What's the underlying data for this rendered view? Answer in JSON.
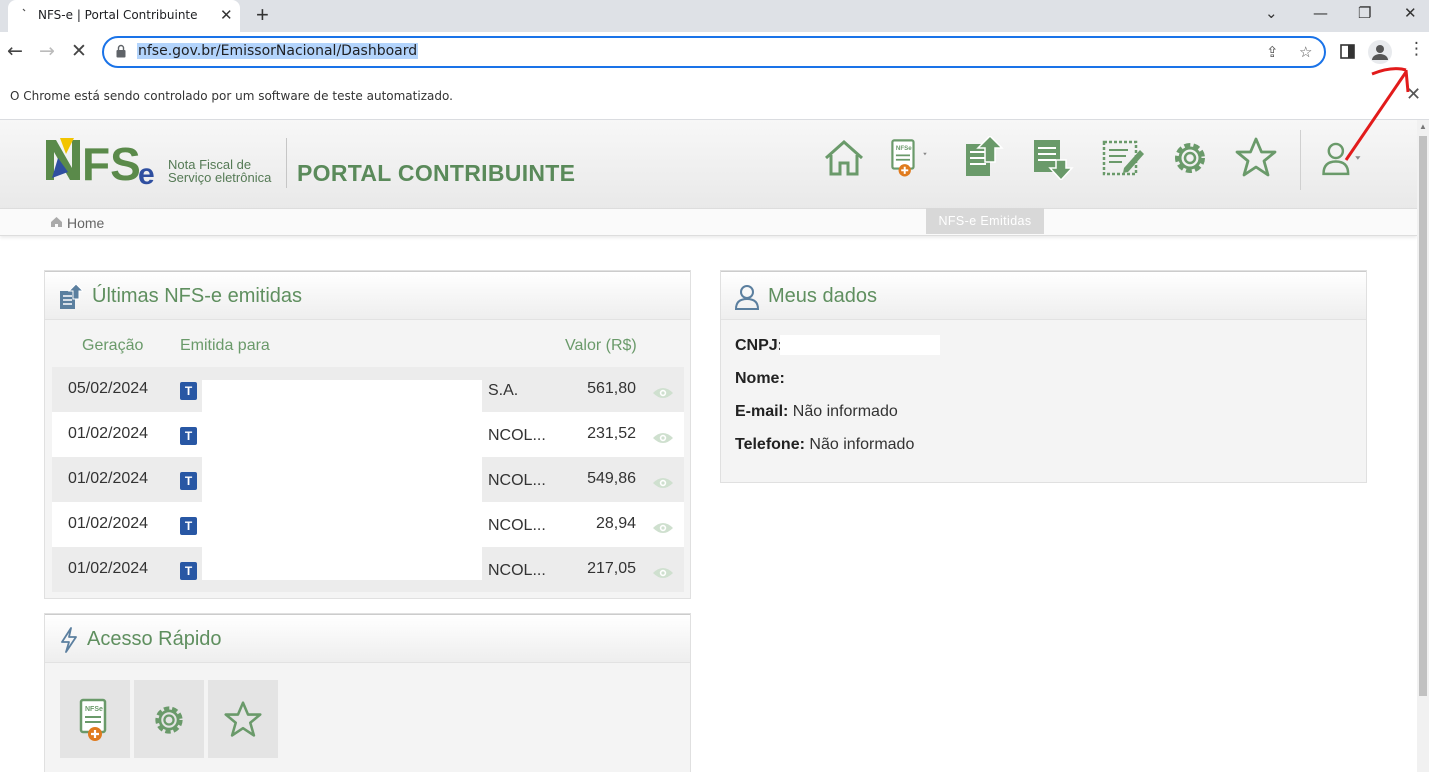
{
  "browser": {
    "tab_title": "NFS-e | Portal Contribuinte",
    "tab_close": "✕",
    "new_tab": "+",
    "url": "nfse.gov.br/EmissorNacional/Dashboard",
    "infobar_text": "O Chrome está sendo controlado por um software de teste automatizado.",
    "infobar_close": "✕",
    "accent": "#1a73e8"
  },
  "header": {
    "logo_nota": "Nota Fiscal de",
    "logo_servico": "Serviço eletrônica",
    "portal_title": "PORTAL CONTRIBUINTE",
    "brand_color": "#5a8a5a",
    "nav_icons": [
      "home-icon",
      "nfse-new-icon",
      "nfse-emitidas-icon",
      "nfse-recebidas-icon",
      "nfse-edit-icon",
      "gear-icon",
      "star-icon",
      "user-icon"
    ],
    "tooltip": "NFS-e Emitidas"
  },
  "breadcrumb": {
    "home": "Home"
  },
  "ultimas": {
    "title": "Últimas NFS-e emitidas",
    "col_geracao": "Geração",
    "col_emitida": "Emitida para",
    "col_valor": "Valor (R$)",
    "rows": [
      {
        "date": "05/02/2024",
        "badge": "T",
        "name": "S.A.",
        "value": "561,80"
      },
      {
        "date": "01/02/2024",
        "badge": "T",
        "name": "NCOL...",
        "value": "231,52"
      },
      {
        "date": "01/02/2024",
        "badge": "T",
        "name": "NCOL...",
        "value": "549,86"
      },
      {
        "date": "01/02/2024",
        "badge": "T",
        "name": "NCOL...",
        "value": "28,94"
      },
      {
        "date": "01/02/2024",
        "badge": "T",
        "name": "NCOL...",
        "value": "217,05"
      }
    ]
  },
  "meus_dados": {
    "title": "Meus dados",
    "cnpj_label": "CNPJ:",
    "nome_label": "Nome:",
    "email_label": "E-mail:",
    "email_value": "Não informado",
    "telefone_label": "Telefone:",
    "telefone_value": "Não informado"
  },
  "acesso": {
    "title": "Acesso Rápido",
    "buttons": [
      "nfse-new-icon",
      "gear-icon",
      "star-icon"
    ]
  }
}
